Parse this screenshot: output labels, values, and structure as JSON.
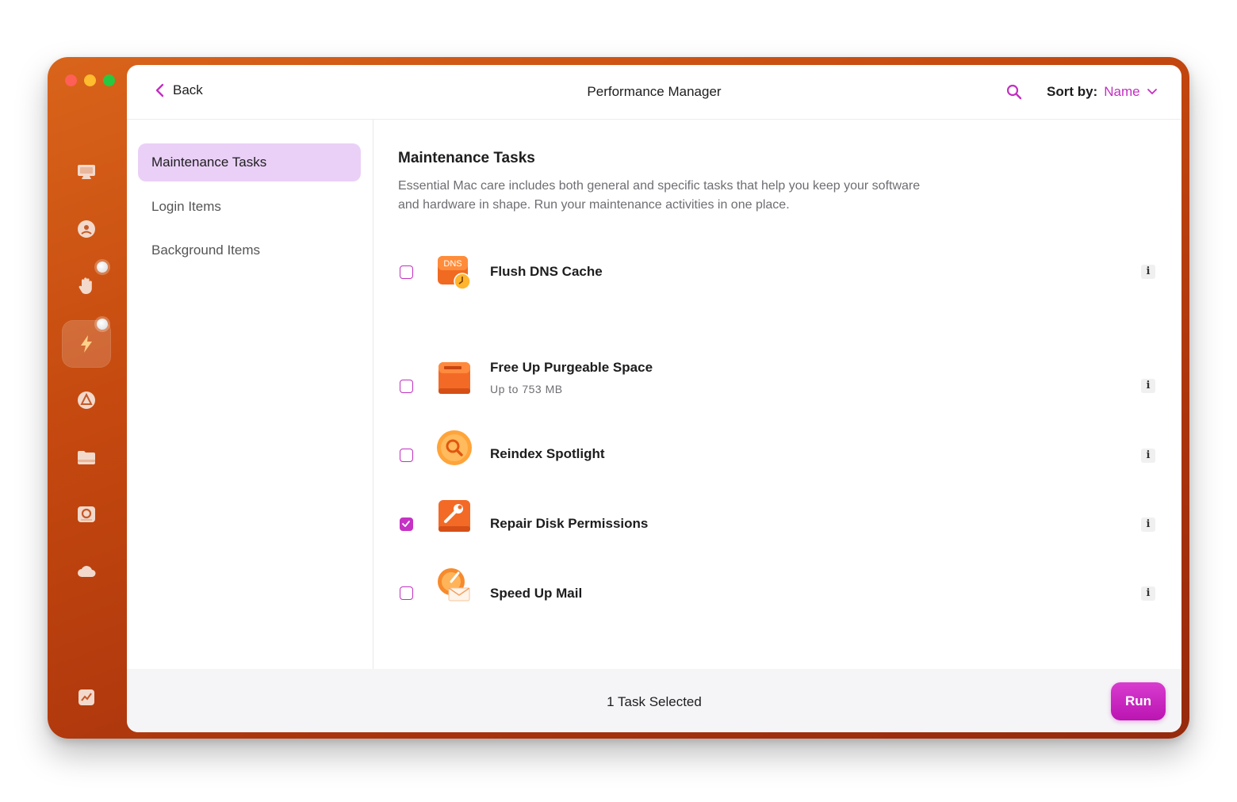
{
  "header": {
    "back_label": "Back",
    "title": "Performance Manager",
    "sort_label": "Sort by:",
    "sort_value": "Name"
  },
  "sidebar": {
    "items": [
      {
        "label": "Maintenance Tasks",
        "active": true
      },
      {
        "label": "Login Items",
        "active": false
      },
      {
        "label": "Background Items",
        "active": false
      }
    ]
  },
  "main": {
    "section_title": "Maintenance Tasks",
    "section_desc": "Essential Mac care includes both general and specific tasks that help you keep your software and hardware in shape. Run your maintenance activities in one place.",
    "tasks": [
      {
        "name": "Flush DNS Cache",
        "sub": "",
        "checked": false,
        "icon": "dns-cache-icon",
        "icon_text": "DNS"
      },
      {
        "name": "Free Up Purgeable Space",
        "sub": "Up to 753 MB",
        "checked": false,
        "icon": "drive-icon"
      },
      {
        "name": "Reindex Spotlight",
        "sub": "",
        "checked": false,
        "icon": "spotlight-icon"
      },
      {
        "name": "Repair Disk Permissions",
        "sub": "",
        "checked": true,
        "icon": "wrench-disk-icon"
      },
      {
        "name": "Speed Up Mail",
        "sub": "",
        "checked": false,
        "icon": "mail-speed-icon"
      }
    ],
    "info_glyph": "i"
  },
  "footer": {
    "selected_text": "1 Task Selected",
    "run_label": "Run"
  },
  "rail": {
    "icons": [
      "monitor-icon",
      "shield-icon",
      "hand-icon",
      "lightning-icon",
      "applications-icon",
      "folder-icon",
      "disk-search-icon",
      "cloud-icon",
      "chart-icon"
    ]
  },
  "colors": {
    "accent": "#c532c4",
    "sidebar_active": "#ead0f7",
    "window_gradient_start": "#d9641a",
    "window_gradient_end": "#962a0c"
  }
}
